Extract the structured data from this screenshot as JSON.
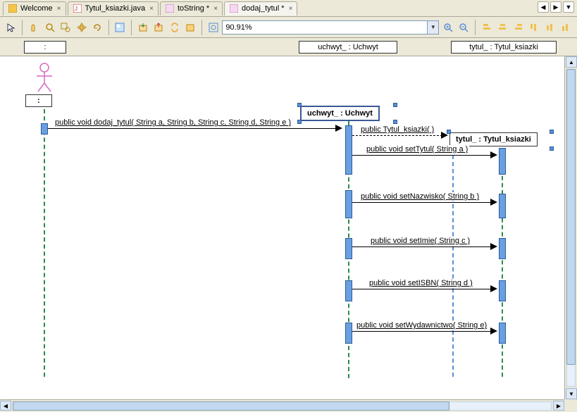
{
  "tabs": [
    {
      "label": "Welcome",
      "icon": "welcome"
    },
    {
      "label": "Tytul_ksiazki.java",
      "icon": "java"
    },
    {
      "label": "toString *",
      "icon": "diagram"
    },
    {
      "label": "dodaj_tytul *",
      "icon": "diagram",
      "active": true
    }
  ],
  "toolbar": {
    "zoom_value": "90.91%"
  },
  "lifelines_header": {
    "actor": ":",
    "uchwyt": "uchwyt_ : Uchwyt",
    "tytul": "tytul_ : Tytul_ksiazki"
  },
  "diagram": {
    "actor_label": ":",
    "uchwyt_label": "uchwyt_ : Uchwyt",
    "tytul_label": "tytul_ : Tytul_ksiazki",
    "messages": {
      "m1": "public void  dodaj_tytul( String a, String b, String c, String d, String e )",
      "m2": "public Tytul_ksiazki( )",
      "m3": "public void  setTytul( String a )",
      "m4": "public void  setNazwisko( String b )",
      "m5": "public void  setImie( String c )",
      "m6": "public void  setISBN( String d )",
      "m7": "public void  setWydawnictwo( String e)"
    }
  }
}
